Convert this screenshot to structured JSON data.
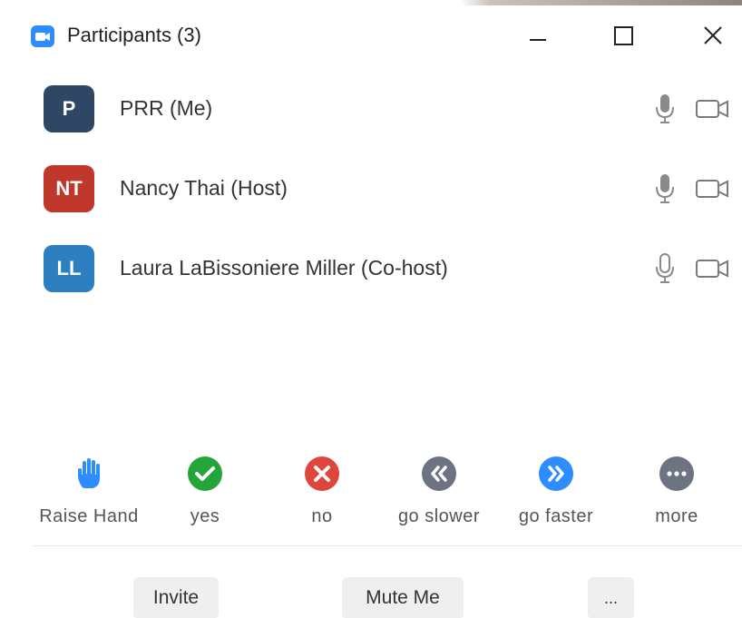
{
  "window": {
    "title": "Participants (3)"
  },
  "participants": [
    {
      "initials": "P",
      "name": "PRR (Me)",
      "avatar_color": "#2f4764",
      "mic": "mic-icon",
      "video": "video-icon"
    },
    {
      "initials": "NT",
      "name": "Nancy Thai (Host)",
      "avatar_color": "#c0382b",
      "mic": "mic-icon",
      "video": "video-icon"
    },
    {
      "initials": "LL",
      "name": "Laura LaBissoniere Miller (Co-host)",
      "avatar_color": "#2e7fbf",
      "mic": "mic-icon",
      "video": "video-icon"
    }
  ],
  "reactions": [
    {
      "label": "Raise Hand",
      "icon": "raise-hand-icon",
      "color": "#2d8cff"
    },
    {
      "label": "yes",
      "icon": "check-icon",
      "color": "#23a53a"
    },
    {
      "label": "no",
      "icon": "x-icon",
      "color": "#e0453b"
    },
    {
      "label": "go slower",
      "icon": "rewind-icon",
      "color": "#6e7382"
    },
    {
      "label": "go faster",
      "icon": "fast-forward-icon",
      "color": "#2d8cff"
    },
    {
      "label": "more",
      "icon": "ellipsis-icon",
      "color": "#6e7382"
    }
  ],
  "bottom": {
    "invite_label": "Invite",
    "mute_label": "Mute Me",
    "more_label": "..."
  },
  "colors": {
    "accent": "#2d8cff",
    "button_bg": "#efefef"
  }
}
